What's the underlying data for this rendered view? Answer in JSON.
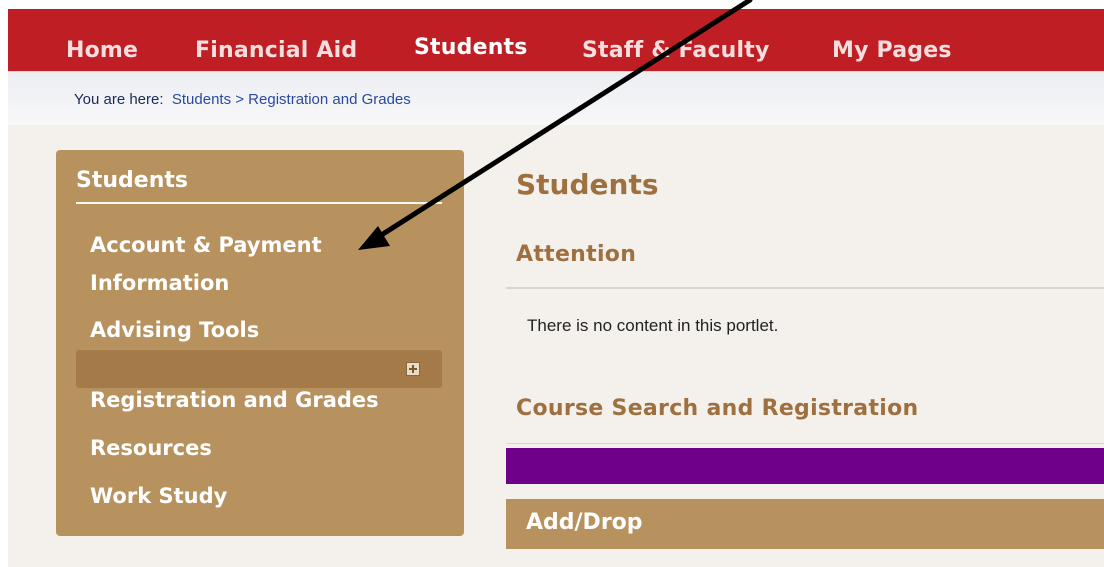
{
  "nav": {
    "items": [
      {
        "label": "Home"
      },
      {
        "label": "Financial Aid"
      },
      {
        "label": "Students"
      },
      {
        "label": "Staff & Faculty"
      },
      {
        "label": "My Pages"
      }
    ]
  },
  "breadcrumb": {
    "lead": "You are here:",
    "path": "Students > Registration and Grades"
  },
  "sidebar": {
    "title": "Students",
    "items": [
      {
        "label": "Account & Payment Information"
      },
      {
        "label": "Advising Tools"
      },
      {
        "label": "Registration and Grades"
      },
      {
        "label": "Resources"
      },
      {
        "label": "Work Study"
      }
    ],
    "expand_icon": "plus-box-icon"
  },
  "main": {
    "title": "Students",
    "attention": {
      "title": "Attention",
      "message": "There is no content in this portlet."
    },
    "course_search": {
      "title": "Course Search and Registration"
    },
    "add_drop": {
      "label": "Add/Drop"
    }
  },
  "annotation": {
    "icon": "arrow-icon",
    "color": "#000000"
  },
  "colors": {
    "nav_bg": "#bf1f24",
    "sidebar_bg": "#b8925e",
    "heading": "#9e7040",
    "purple_bar": "#6f008a"
  }
}
